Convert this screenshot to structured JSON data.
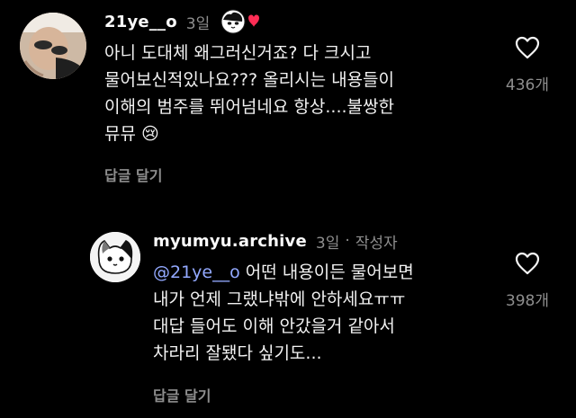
{
  "comments": [
    {
      "username": "21ye__o",
      "time": "3일",
      "lines": [
        "아니 도대체 왜그러신거죠? 다 크시고",
        "물어보신적있나요??? 올리시는 내용들이",
        "이해의 범주를 뛰어넘네요 항상....불쌍한",
        "뮤뮤 😢"
      ],
      "reply_label": "답글 달기",
      "like_count": "436개",
      "icons": {
        "like": "heart-outline-icon",
        "badge": "creator-liked-heart-icon"
      }
    },
    {
      "username": "myumyu.archive",
      "time": "3일",
      "separator": "·",
      "author_tag": "작성자",
      "mention": "@21ye__o",
      "lines": [
        " 어떤 내용이든 물어보면",
        "내가 언제 그랬냐밖에 안하세요ㅠㅠ",
        "대답 들어도 이해 안갔을거 같아서",
        "차라리 잘됐다 싶기도..."
      ],
      "reply_label": "답글 달기",
      "like_count": "398개",
      "icons": {
        "like": "heart-outline-icon"
      }
    }
  ],
  "colors": {
    "background": "#000000",
    "mention": "#93a9ff",
    "muted": "#8e8e8e",
    "badge_heart": "#ff2d55"
  }
}
